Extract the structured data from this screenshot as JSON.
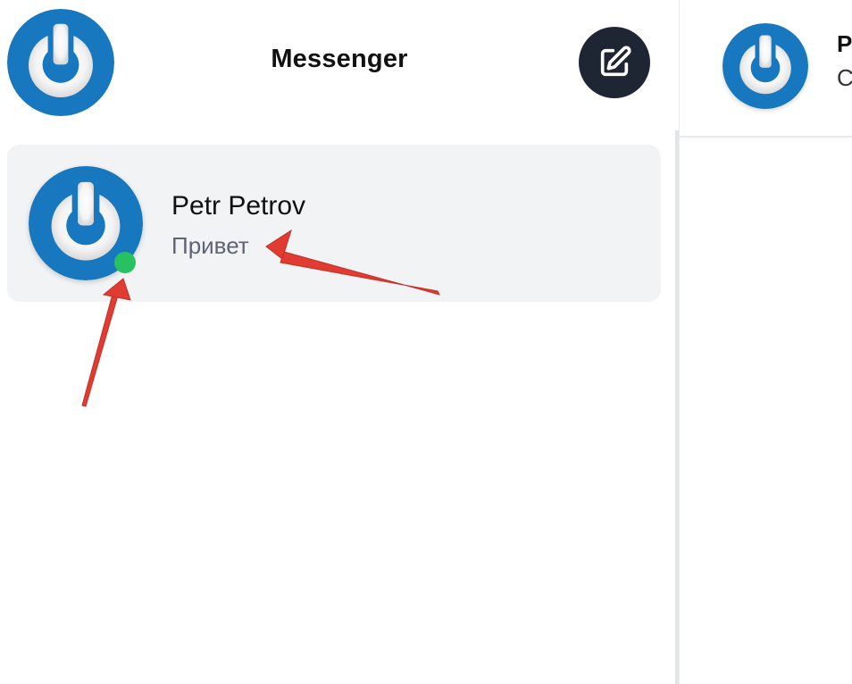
{
  "sidebar": {
    "title": "Messenger",
    "current_user_avatar_icon": "power-logo-avatar",
    "compose_button_icon": "edit-icon",
    "conversations": [
      {
        "name": "Petr Petrov",
        "last_message": "Привет",
        "online": true,
        "avatar_icon": "power-logo-avatar"
      }
    ]
  },
  "chat": {
    "title": "Pe",
    "status": "C",
    "avatar_icon": "power-logo-avatar"
  },
  "colors": {
    "avatar_blue": "#1778bf",
    "online_green": "#27c160",
    "compose_bg": "#1f2633",
    "conversation_bg": "#f2f3f5",
    "annotation_red": "#e03c31"
  }
}
